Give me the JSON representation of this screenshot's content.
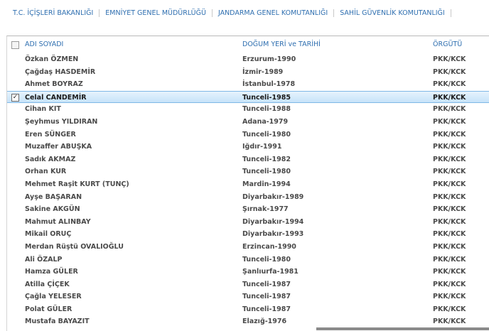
{
  "nav": [
    {
      "label": "T.C. İÇİŞLERİ BAKANLIĞI"
    },
    {
      "label": "EMNİYET GENEL MÜDÜRLÜĞÜ"
    },
    {
      "label": "JANDARMA GENEL KOMUTANLIĞI"
    },
    {
      "label": "SAHİL GÜVENLİK KOMUTANLIĞI"
    }
  ],
  "table": {
    "headers": {
      "name": "ADI SOYADI",
      "birth": "DOĞUM YERİ ve TARİHİ",
      "org": "ÖRGÜTÜ"
    },
    "rows": [
      {
        "name": "Özkan ÖZMEN",
        "birth": "Erzurum-1990",
        "org": "PKK/KCK"
      },
      {
        "name": "Çağdaş HASDEMİR",
        "birth": "İzmir-1989",
        "org": "PKK/KCK"
      },
      {
        "name": "Ahmet BOYRAZ",
        "birth": "İstanbul-1978",
        "org": "PKK/KCK"
      },
      {
        "name": "Celal CANDEMİR",
        "birth": "Tunceli-1985",
        "org": "PKK/KCK"
      },
      {
        "name": "Cihan KIT",
        "birth": "Tunceli-1988",
        "org": "PKK/KCK"
      },
      {
        "name": "Şeyhmus YILDIRAN",
        "birth": "Adana-1979",
        "org": "PKK/KCK"
      },
      {
        "name": "Eren SÜNGER",
        "birth": "Tunceli-1980",
        "org": "PKK/KCK"
      },
      {
        "name": "Muzaffer ABUŞKA",
        "birth": "Iğdır-1991",
        "org": "PKK/KCK"
      },
      {
        "name": "Sadık AKMAZ",
        "birth": "Tunceli-1982",
        "org": "PKK/KCK"
      },
      {
        "name": "Orhan KUR",
        "birth": "Tunceli-1980",
        "org": "PKK/KCK"
      },
      {
        "name": "Mehmet Raşit KURT (TUNÇ)",
        "birth": "Mardin-1994",
        "org": "PKK/KCK"
      },
      {
        "name": "Ayşe BAŞARAN",
        "birth": "Diyarbakır-1989",
        "org": "PKK/KCK"
      },
      {
        "name": "Sakine AKGÜN",
        "birth": "Şırnak-1977",
        "org": "PKK/KCK"
      },
      {
        "name": "Mahmut ALINBAY",
        "birth": "Diyarbakır-1994",
        "org": "PKK/KCK"
      },
      {
        "name": "Mikail ORUÇ",
        "birth": "Diyarbakır-1993",
        "org": "PKK/KCK"
      },
      {
        "name": "Merdan Rüştü OVALIOĞLU",
        "birth": "Erzincan-1990",
        "org": "PKK/KCK"
      },
      {
        "name": "Ali ÖZALP",
        "birth": "Tunceli-1980",
        "org": "PKK/KCK"
      },
      {
        "name": "Hamza GÜLER",
        "birth": "Şanlıurfa-1981",
        "org": "PKK/KCK"
      },
      {
        "name": "Atilla ÇİÇEK",
        "birth": "Tunceli-1987",
        "org": "PKK/KCK"
      },
      {
        "name": "Çağla YELESER",
        "birth": "Tunceli-1987",
        "org": "PKK/KCK"
      },
      {
        "name": "Polat GÜLER",
        "birth": "Tunceli-1987",
        "org": "PKK/KCK"
      },
      {
        "name": "Mustafa BAYAZIT",
        "birth": "Elazığ-1976",
        "org": "PKK/KCK"
      }
    ],
    "selected_row": 3,
    "check_mark": "✓"
  },
  "colors": {
    "link": "#2f6fb0",
    "text": "#4a4a4a",
    "selected_bg": "#c7e3f9"
  }
}
